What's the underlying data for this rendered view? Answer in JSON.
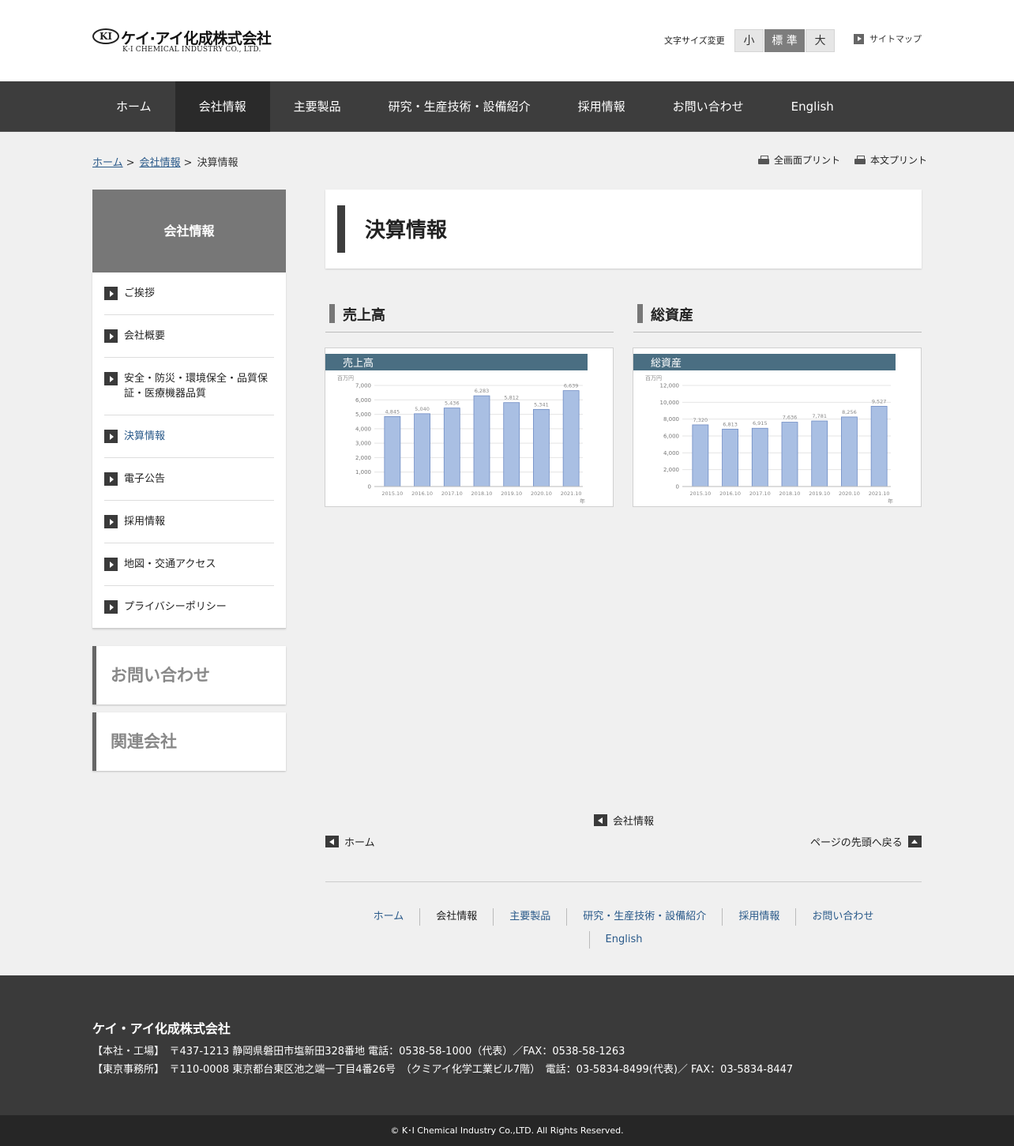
{
  "header": {
    "logo_jp": "ケイ·アイ化成株式会社",
    "logo_en": "K·I CHEMICAL INDUSTRY CO., LTD.",
    "logo_mark": "KI",
    "font_size_label": "文字サイズ変更",
    "font_sizes": [
      "小",
      "標 準",
      "大"
    ],
    "sitemap": "サイトマップ"
  },
  "gnav": [
    "ホーム",
    "会社情報",
    "主要製品",
    "研究・生産技術・設備紹介",
    "採用情報",
    "お問い合わせ",
    "English"
  ],
  "breadcrumb": {
    "home": "ホーム",
    "company": "会社情報",
    "current": "決算情報",
    "sep": ">"
  },
  "print": {
    "full": "全画面プリント",
    "body": "本文プリント"
  },
  "sidebar": {
    "title": "会社情報",
    "items": [
      "ご挨拶",
      "会社概要",
      "安全・防災・環境保全・品質保証・医療機器品質",
      "決算情報",
      "電子公告",
      "採用情報",
      "地図・交通アクセス",
      "プライバシーポリシー"
    ],
    "banners": [
      "お問い合わせ",
      "関連会社"
    ]
  },
  "main": {
    "title": "決算情報",
    "sections": [
      "売上高",
      "総資産"
    ]
  },
  "chart_data": [
    {
      "type": "bar",
      "title": "売上高",
      "ylabel": "百万円",
      "xlabel": "年",
      "categories": [
        "2015.10",
        "2016.10",
        "2017.10",
        "2018.10",
        "2019.10",
        "2020.10",
        "2021.10"
      ],
      "values": [
        4845,
        5040,
        5436,
        6283,
        5812,
        5341,
        6639
      ],
      "value_labels": [
        "4,845",
        "5,040",
        "5,436",
        "6,283",
        "5,812",
        "5,341",
        "6,639"
      ],
      "yticks": [
        "0",
        "1,000",
        "2,000",
        "3,000",
        "4,000",
        "5,000",
        "6,000",
        "7,000"
      ],
      "ylim": [
        0,
        7000
      ],
      "header_color": "#4a6e82",
      "bar_color": "#a9bfe3"
    },
    {
      "type": "bar",
      "title": "総資産",
      "ylabel": "百万円",
      "xlabel": "年",
      "categories": [
        "2015.10",
        "2016.10",
        "2017.10",
        "2018.10",
        "2019.10",
        "2020.10",
        "2021.10"
      ],
      "values": [
        7320,
        6813,
        6915,
        7636,
        7781,
        8256,
        9527
      ],
      "value_labels": [
        "7,320",
        "6,813",
        "6,915",
        "7,636",
        "7,781",
        "8,256",
        "9,527"
      ],
      "yticks": [
        "0",
        "2,000",
        "4,000",
        "6,000",
        "8,000",
        "10,000",
        "12,000"
      ],
      "ylim": [
        0,
        12000
      ],
      "header_color": "#4a6e82",
      "bar_color": "#a9bfe3"
    }
  ],
  "bottom_links": {
    "parent": "会社情報",
    "home": "ホーム",
    "top": "ページの先頭へ戻る"
  },
  "footer_nav": [
    "ホーム",
    "会社情報",
    "主要製品",
    "研究・生産技術・設備紹介",
    "採用情報",
    "お問い合わせ",
    "English"
  ],
  "footer": {
    "company": "ケイ・アイ化成株式会社",
    "line1": "【本社・工場】　〒437-1213 静岡県磐田市塩新田328番地 電話：0538-58-1000（代表）／FAX：0538-58-1263",
    "line2": "【東京事務所】　〒110-0008 東京都台東区池之端一丁目4番26号　（クミアイ化学工業ビル7階）　電話：03-5834-8499(代表)／ FAX：03-5834-8447",
    "copyright": "© K･I Chemical Industry Co.,LTD. All Rights Reserved."
  }
}
